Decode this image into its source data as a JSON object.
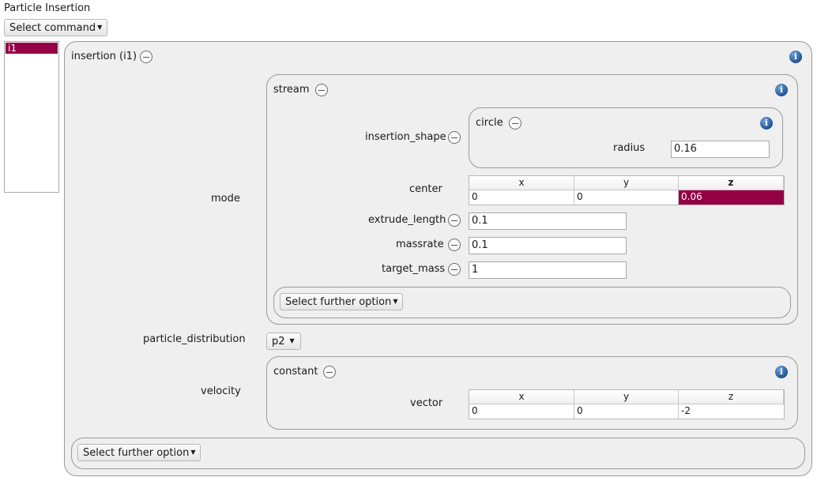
{
  "window": {
    "title": "Particle Insertion"
  },
  "toolbar": {
    "select_command": "Select command"
  },
  "commands_list": [
    "i1"
  ],
  "insertion": {
    "title": "insertion (i1)",
    "mode": {
      "label": "mode",
      "stream": {
        "title": "stream",
        "insertion_shape": {
          "label": "insertion_shape",
          "circle": {
            "title": "circle",
            "radius_label": "radius",
            "radius_value": "0.16"
          }
        },
        "center": {
          "label": "center",
          "headers": [
            "x",
            "y",
            "z"
          ],
          "values": [
            "0",
            "0",
            "0.06"
          ]
        },
        "extrude_length": {
          "label": "extrude_length",
          "value": "0.1"
        },
        "massrate": {
          "label": "massrate",
          "value": "0.1"
        },
        "target_mass": {
          "label": "target_mass",
          "value": "1"
        },
        "further_option": "Select further option"
      }
    },
    "particle_distribution": {
      "label": "particle_distribution",
      "value": "p2"
    },
    "velocity": {
      "label": "velocity",
      "constant": {
        "title": "constant",
        "vector": {
          "label": "vector",
          "headers": [
            "x",
            "y",
            "z"
          ],
          "values": [
            "0",
            "0",
            "-2"
          ]
        }
      }
    },
    "further_option": "Select further option"
  },
  "colors": {
    "selection": "#940043",
    "info": "#1b4f8e"
  },
  "icons": {
    "collapse": "minus-circle-icon",
    "info": "info-icon",
    "dropdown": "caret-down-icon"
  }
}
